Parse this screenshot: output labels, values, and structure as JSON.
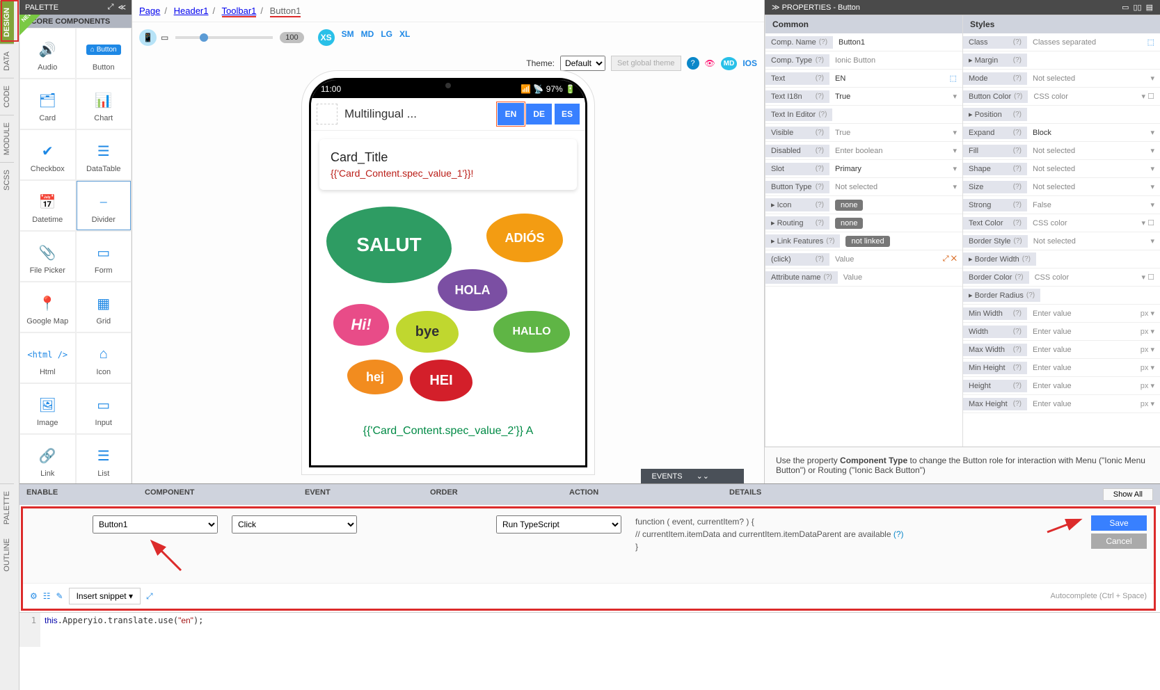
{
  "left_tabs": {
    "design": "DESIGN",
    "data": "DATA",
    "code": "CODE",
    "module": "MODULE",
    "scss": "SCSS",
    "palette": "PALETTE",
    "outline": "OUTLINE"
  },
  "palette": {
    "title": "PALETTE",
    "section": "CORE COMPONENTS",
    "new": "NEW",
    "items": [
      {
        "label": "Audio"
      },
      {
        "label": "Button"
      },
      {
        "label": "Card"
      },
      {
        "label": "Chart"
      },
      {
        "label": "Checkbox"
      },
      {
        "label": "DataTable"
      },
      {
        "label": "Datetime"
      },
      {
        "label": "Divider"
      },
      {
        "label": "File Picker"
      },
      {
        "label": "Form"
      },
      {
        "label": "Google Map"
      },
      {
        "label": "Grid"
      },
      {
        "label": "Html"
      },
      {
        "label": "Icon"
      },
      {
        "label": "Image"
      },
      {
        "label": "Input"
      },
      {
        "label": "Link"
      },
      {
        "label": "List"
      }
    ]
  },
  "breadcrumbs": {
    "p": "Page",
    "h": "Header1",
    "t": "Toolbar1",
    "b": "Button1"
  },
  "preview": {
    "slider_val": "100",
    "bps": [
      "XS",
      "SM",
      "MD",
      "LG",
      "XL"
    ],
    "theme_label": "Theme:",
    "theme_value": "Default",
    "set_global": "Set global theme",
    "md": "MD",
    "ios": "IOS"
  },
  "phone": {
    "time": "11:00",
    "battery": "97%",
    "app_title": "Multilingual ...",
    "langs": [
      "EN",
      "DE",
      "ES"
    ],
    "card": {
      "title": "Card_Title",
      "sub": "{{'Card_Content.spec_value_1'}}!"
    },
    "bubbles": {
      "salut": "SALUT",
      "adios": "ADIÓS",
      "hola": "HOLA",
      "hi": "Hi!",
      "bye": "bye",
      "hallo": "HALLO",
      "hej": "hej",
      "hei": "HEI"
    },
    "footer": "{{'Card_Content.spec_value_2'}} A"
  },
  "right": {
    "title": "PROPERTIES - Button",
    "common": "Common",
    "styles": "Styles",
    "rows_common": [
      {
        "l": "Comp. Name",
        "v": "Button1",
        "filled": true
      },
      {
        "l": "Comp. Type",
        "v": "Ionic Button"
      },
      {
        "l": "Text",
        "v": "EN",
        "filled": true,
        "icon": true
      },
      {
        "l": "Text I18n",
        "v": "True",
        "filled": true,
        "dd": true
      },
      {
        "l": "Text In Editor",
        "v": ""
      },
      {
        "l": "Visible",
        "v": "True",
        "dd": true
      },
      {
        "l": "Disabled",
        "v": "Enter boolean",
        "dd": true
      },
      {
        "l": "Slot",
        "v": "Primary",
        "filled": true,
        "dd": true
      },
      {
        "l": "Button Type",
        "v": "Not selected",
        "dd": true
      },
      {
        "l": "Icon",
        "v": "none",
        "chip": true,
        "exp": true
      },
      {
        "l": "Routing",
        "v": "none",
        "chip": true,
        "exp": true
      },
      {
        "l": "Link Features",
        "v": "not linked",
        "chip": true,
        "exp": true
      },
      {
        "l": "(click)",
        "v": "Value",
        "click": true
      },
      {
        "l": "Attribute name",
        "v": "Value",
        "attr": true
      }
    ],
    "rows_styles": [
      {
        "l": "Class",
        "v": "Classes separated",
        "icon": true
      },
      {
        "l": "Margin",
        "v": "",
        "exp": true
      },
      {
        "l": "Mode",
        "v": "Not selected",
        "dd": true
      },
      {
        "l": "Button Color",
        "v": "CSS color",
        "color": true
      },
      {
        "l": "Position",
        "v": "",
        "exp": true
      },
      {
        "l": "Expand",
        "v": "Block",
        "filled": true,
        "dd": true
      },
      {
        "l": "Fill",
        "v": "Not selected",
        "dd": true
      },
      {
        "l": "Shape",
        "v": "Not selected",
        "dd": true
      },
      {
        "l": "Size",
        "v": "Not selected",
        "dd": true
      },
      {
        "l": "Strong",
        "v": "False",
        "dd": true
      },
      {
        "l": "Text Color",
        "v": "CSS color",
        "color": true
      },
      {
        "l": "Border Style",
        "v": "Not selected",
        "dd": true
      },
      {
        "l": "Border Width",
        "v": "",
        "exp": true
      },
      {
        "l": "Border Color",
        "v": "CSS color",
        "color": true
      },
      {
        "l": "Border Radius",
        "v": "",
        "exp": true
      },
      {
        "l": "Min Width",
        "v": "Enter value",
        "unit": "px"
      },
      {
        "l": "Width",
        "v": "Enter value",
        "unit": "px"
      },
      {
        "l": "Max Width",
        "v": "Enter value",
        "unit": "px"
      },
      {
        "l": "Min Height",
        "v": "Enter value",
        "unit": "px"
      },
      {
        "l": "Height",
        "v": "Enter value",
        "unit": "px"
      },
      {
        "l": "Max Height",
        "v": "Enter value",
        "unit": "px"
      }
    ],
    "hint_pre": "Use the property ",
    "hint_b": "Component Type",
    "hint_post": " to change the Button role for interaction with Menu (\"Ionic Menu Button\") or Routing (\"Ionic Back Button\")"
  },
  "events": {
    "tab": "EVENTS",
    "headers": [
      "ENABLE",
      "COMPONENT",
      "EVENT",
      "ORDER",
      "ACTION",
      "DETAILS"
    ],
    "show_all": "Show All",
    "component": "Button1",
    "event": "Click",
    "action": "Run TypeScript",
    "fn1": "function ( event, currentItem? ) {",
    "fn2": "// currentItem.itemData and currentItem.itemDataParent are available ",
    "fn3": "}",
    "save": "Save",
    "cancel": "Cancel",
    "snippet": "Insert snippet",
    "autocomplete": "Autocomplete (Ctrl + Space)",
    "code": "this.Apperyio.translate.use(\"en\");"
  }
}
